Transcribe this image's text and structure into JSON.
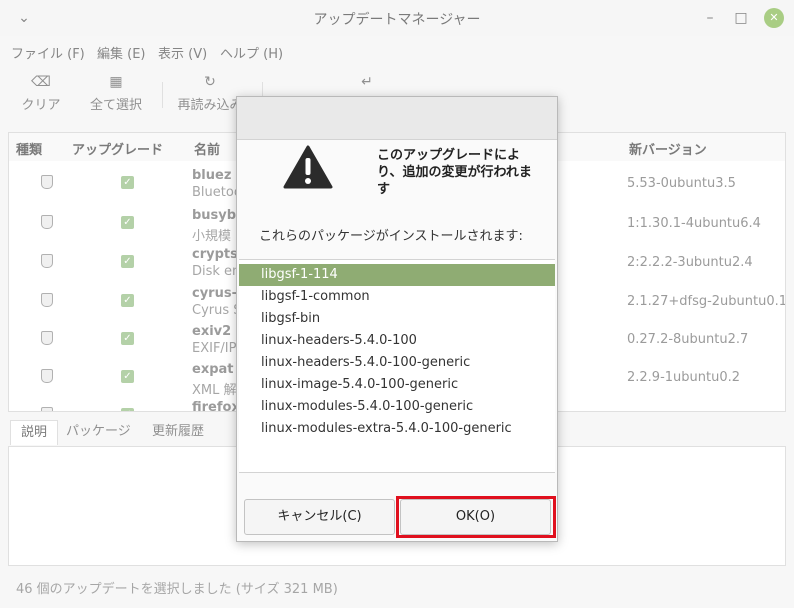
{
  "window": {
    "title": "アップデートマネージャー"
  },
  "menu": [
    "ファイル (F)",
    "編集 (E)",
    "表示 (V)",
    "ヘルプ (H)"
  ],
  "toolbar": {
    "clear": "クリア",
    "select_all": "全て選択",
    "refresh": "再読み込み"
  },
  "table": {
    "headers": {
      "type": "種類",
      "upgrade": "アップグレード",
      "name": "名前",
      "new_version": "新バージョン"
    },
    "rows": [
      {
        "name": "bluez",
        "desc": "Bluetoo",
        "version": "5.53-0ubuntu3.5"
      },
      {
        "name": "busybox",
        "desc": "小規模",
        "version": "1:1.30.1-4ubuntu6.4"
      },
      {
        "name": "cryptse",
        "desc": "Disk en",
        "version": "2:2.2.2-3ubuntu2.4"
      },
      {
        "name": "cyrus-s",
        "desc": "Cyrus S",
        "version": "2.1.27+dfsg-2ubuntu0.1"
      },
      {
        "name": "exiv2",
        "desc": "EXIF/IP",
        "version": "0.27.2-8ubuntu2.7"
      },
      {
        "name": "expat",
        "desc": "XML 解",
        "version": "2.2.9-1ubuntu0.2"
      },
      {
        "name": "firefox",
        "desc": "",
        "version": ""
      }
    ]
  },
  "tabs": [
    "説明",
    "パッケージ",
    "更新履歴"
  ],
  "status": "46 個のアップデートを選択しました (サイズ 321 MB)",
  "dialog": {
    "heading": "このアップグレードにより、追加の変更が行われます",
    "subheading": "これらのパッケージがインストールされます:",
    "packages": [
      "libgsf-1-114",
      "libgsf-1-common",
      "libgsf-bin",
      "linux-headers-5.4.0-100",
      "linux-headers-5.4.0-100-generic",
      "linux-image-5.4.0-100-generic",
      "linux-modules-5.4.0-100-generic",
      "linux-modules-extra-5.4.0-100-generic"
    ],
    "cancel": "キャンセル(C)",
    "ok": "OK(O)"
  },
  "colors": {
    "selection": "#8fac73",
    "highlight": "#e0101e",
    "close_button": "#7cb342"
  }
}
